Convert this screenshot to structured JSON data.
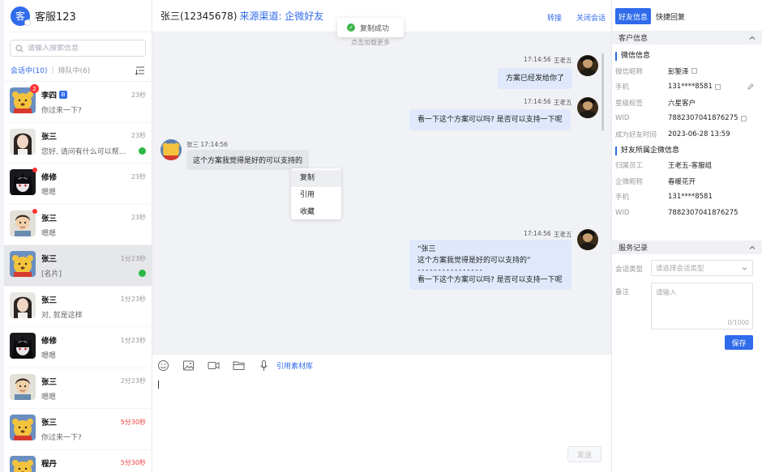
{
  "app": {
    "logo_char": "客",
    "title": "客服123"
  },
  "search": {
    "placeholder": "请输入搜索信息"
  },
  "tabs": {
    "active": "会话中(10)",
    "other": "排队中(6)"
  },
  "conversations": [
    {
      "name": "李四",
      "tag": "B",
      "time": "23秒",
      "msg": "你过来一下?",
      "badge": "2",
      "avatar": "pooh",
      "time_red": false
    },
    {
      "name": "张三",
      "time": "23秒",
      "msg": "您好, 请问有什么可以帮...",
      "avatar": "girl",
      "wechat": true
    },
    {
      "name": "修修",
      "time": "23秒",
      "msg": "嗯嗯",
      "avatar": "anime",
      "dot": true
    },
    {
      "name": "张三",
      "time": "23秒",
      "msg": "嗯嗯",
      "avatar": "boy",
      "dot": true
    },
    {
      "name": "张三",
      "time": "1分23秒",
      "msg": "[名片]",
      "avatar": "pooh",
      "wechat": true,
      "selected": true
    },
    {
      "name": "张三",
      "time": "1分23秒",
      "msg": "对, 就是这样",
      "avatar": "girl"
    },
    {
      "name": "修修",
      "time": "1分23秒",
      "msg": "嗯嗯",
      "avatar": "anime"
    },
    {
      "name": "张三",
      "time": "2分23秒",
      "msg": "嗯嗯",
      "avatar": "boy"
    },
    {
      "name": "张三",
      "time": "5分30秒",
      "msg": "你过来一下?",
      "avatar": "pooh",
      "time_red": true
    },
    {
      "name": "程丹",
      "time": "5分30秒",
      "msg": "",
      "avatar": "pooh",
      "time_red": true
    }
  ],
  "chat": {
    "title": "张三(12345678)",
    "source": "来源渠道: 企微好友",
    "transfer": "转接",
    "close": "关闭会话",
    "toast": "复制成功",
    "load_more": "点击加载更多",
    "messages": {
      "m1_time": "17:14:56",
      "m1_sender": "王老五",
      "m1_text": "方案已经发给你了",
      "m2_time": "17:14:56",
      "m2_sender": "王老五",
      "m2_text": "看一下这个方案可以吗? 是否可以支持一下呢",
      "m3_meta": "张三 17:14:56",
      "m3_text": "这个方案我觉得是好的可以支持的",
      "m4_time": "17:14:56",
      "m4_sender": "王老五",
      "m4_quote_name": "“张三",
      "m4_quote_text": "这个方案我觉得是好的可以支持的”",
      "m4_divider": "- - - - - - - - - - - - - - - -",
      "m4_text": "看一下这个方案可以吗? 是否可以支持一下呢"
    },
    "context_menu": [
      "复制",
      "引用",
      "收藏"
    ],
    "toolbar_link": "引用素材库",
    "send": "发送"
  },
  "right": {
    "tab_active": "好友信息",
    "tab_other": "快捷回复",
    "customer_section": "客户信息",
    "wechat_info_title": "微信信息",
    "wechat_info": [
      {
        "k": "微信昵称",
        "v": "彭錾泽"
      },
      {
        "k": "手机",
        "v": "131****8581"
      },
      {
        "k": "星级标签",
        "v": "六星客户"
      },
      {
        "k": "WID",
        "v": "7882307041876275"
      },
      {
        "k": "成为好友时间",
        "v": "2023-06-28 13:59"
      }
    ],
    "corp_info_title": "好友所属企微信息",
    "corp_info": [
      {
        "k": "归属员工",
        "v": "王老五-客服组"
      },
      {
        "k": "企微昵称",
        "v": "春暖花开"
      },
      {
        "k": "手机",
        "v": "131****8581"
      },
      {
        "k": "WID",
        "v": "7882307041876275"
      }
    ],
    "service_section": "服务记录",
    "session_type_label": "会话类型",
    "session_type_placeholder": "请选择会话类型",
    "note_label": "备注",
    "note_placeholder": "请输入",
    "note_count": "0/1000",
    "save": "保存"
  },
  "colors": {
    "accent": "#2f6bea",
    "wechat_green": "#2cb845",
    "alert_red": "#f04040"
  }
}
